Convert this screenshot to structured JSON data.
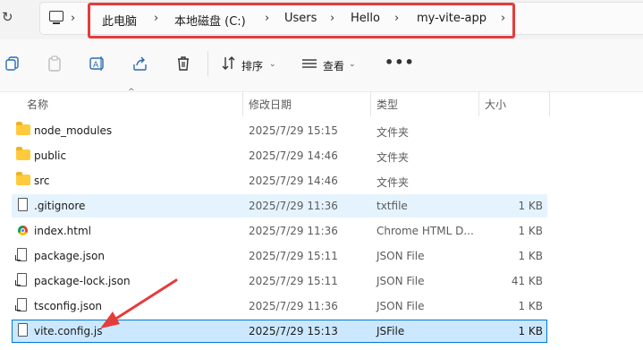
{
  "breadcrumbs": [
    "此电脑",
    "本地磁盘 (C:)",
    "Users",
    "Hello",
    "my-vite-app"
  ],
  "toolbar": {
    "sort_label": "排序",
    "view_label": "查看",
    "more_label": "•••"
  },
  "columns": {
    "name": "名称",
    "modified": "修改日期",
    "type": "类型",
    "size": "大小"
  },
  "files": [
    {
      "name": "node_modules",
      "modified": "2025/7/29 15:15",
      "type": "文件夹",
      "size": "",
      "icon": "folder-icon"
    },
    {
      "name": "public",
      "modified": "2025/7/29 14:46",
      "type": "文件夹",
      "size": "",
      "icon": "folder-icon"
    },
    {
      "name": "src",
      "modified": "2025/7/29 14:46",
      "type": "文件夹",
      "size": "",
      "icon": "folder-icon"
    },
    {
      "name": ".gitignore",
      "modified": "2025/7/29 11:36",
      "type": "txtfile",
      "size": "1 KB",
      "icon": "file-icon"
    },
    {
      "name": "index.html",
      "modified": "2025/7/29 11:36",
      "type": "Chrome HTML D...",
      "size": "1 KB",
      "icon": "chrome-icon"
    },
    {
      "name": "package.json",
      "modified": "2025/7/29 15:11",
      "type": "JSON File",
      "size": "1 KB",
      "icon": "json-file-icon"
    },
    {
      "name": "package-lock.json",
      "modified": "2025/7/29 15:11",
      "type": "JSON File",
      "size": "41 KB",
      "icon": "json-file-icon"
    },
    {
      "name": "tsconfig.json",
      "modified": "2025/7/29 11:36",
      "type": "JSON File",
      "size": "1 KB",
      "icon": "json-file-icon"
    },
    {
      "name": "vite.config.js",
      "modified": "2025/7/29 15:13",
      "type": "JSFile",
      "size": "1 KB",
      "icon": "js-file-icon"
    }
  ],
  "colors": {
    "highlight_border": "#e63b3b",
    "arrow": "#e63b3b",
    "selection": "#cce8ff",
    "selection_border": "#0078d4",
    "folder": "#ffcb3d"
  }
}
